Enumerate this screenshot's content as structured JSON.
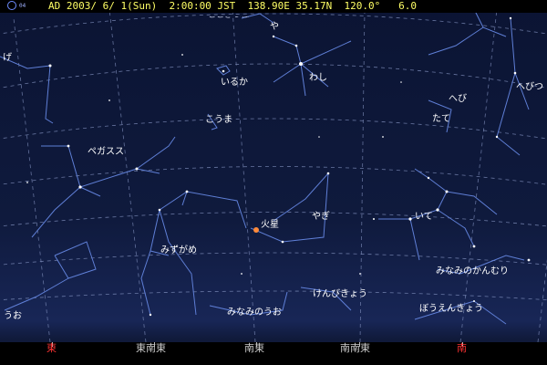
{
  "status": {
    "moon_age": "04",
    "text": "AD 2003/ 6/ 1(Sun)  2:00:00 JST  138.90E 35.17N  120.0°   6.0"
  },
  "constellations": {
    "top_cut": "ここぎつね",
    "ya": "や",
    "ge": "げ",
    "iruka": "いるか",
    "washi": "わし",
    "hebi_e": "へび",
    "hebi_ne": "へびつ",
    "kouma": "こうま",
    "tate": "たて",
    "pegasus": "ペガスス",
    "yagi": "やぎ",
    "ite": "いて",
    "mizugame": "みずがめ",
    "minami_kanmuri": "みなみのかんむり",
    "kenbikyou": "けんびきょう",
    "minami_uo": "みなみのうお",
    "houen": "ぼうえんきょう",
    "uo": "うお"
  },
  "planets": {
    "mars": "火星"
  },
  "directions": {
    "east": "東",
    "ese": "東南東",
    "se": "南東",
    "sse": "南南東",
    "south": "南"
  },
  "colors": {
    "status_text": "#ffff66",
    "cardinal": "#ff3333",
    "constellation_line": "#5f7fd6",
    "grid_line": "#7d8fbf",
    "mars": "#ff8a3a"
  }
}
